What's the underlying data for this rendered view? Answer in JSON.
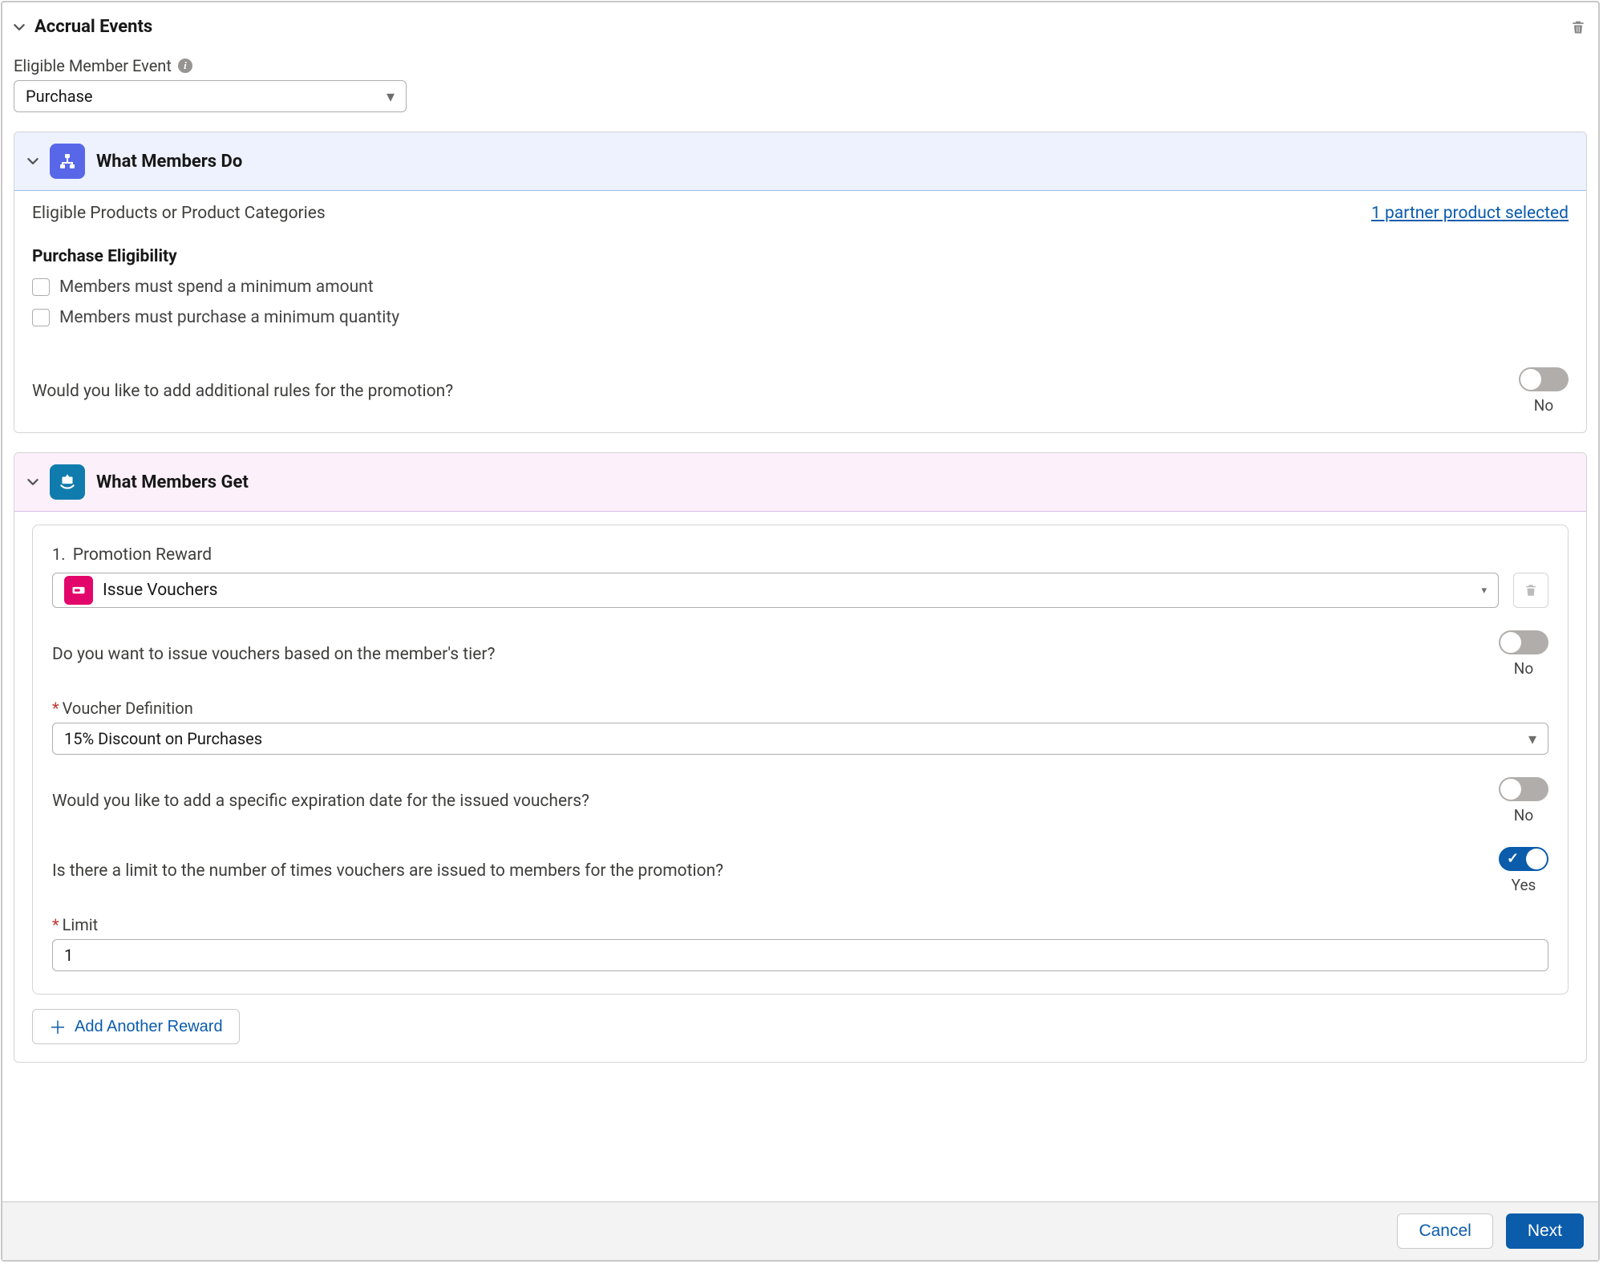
{
  "accrual": {
    "section_title": "Accrual Events",
    "eligible_event_label": "Eligible Member Event",
    "eligible_event_value": "Purchase"
  },
  "what_members_do": {
    "title": "What Members Do",
    "eligible_products_label": "Eligible Products or Product Categories",
    "selected_link": "1 partner product selected",
    "purchase_eligibility_label": "Purchase Eligibility",
    "cb_min_amount": "Members must spend a minimum amount",
    "cb_min_qty": "Members must purchase a minimum quantity",
    "additional_rules_q": "Would you like to add additional rules for the promotion?",
    "additional_rules_toggle": "No"
  },
  "what_members_get": {
    "title": "What Members Get",
    "reward_num": "1.",
    "reward_label": "Promotion Reward",
    "reward_value": "Issue Vouchers",
    "tier_q": "Do you want to issue vouchers based on the member's tier?",
    "tier_toggle": "No",
    "voucher_def_label": "Voucher Definition",
    "voucher_def_value": "15% Discount on Purchases",
    "expire_q": "Would you like to add a specific expiration date for the issued vouchers?",
    "expire_toggle": "No",
    "limit_q": "Is there a limit to the number of times vouchers are issued to members for the promotion?",
    "limit_toggle": "Yes",
    "limit_label": "Limit",
    "limit_value": "1",
    "add_reward": "Add Another Reward"
  },
  "footer": {
    "cancel": "Cancel",
    "next": "Next"
  }
}
